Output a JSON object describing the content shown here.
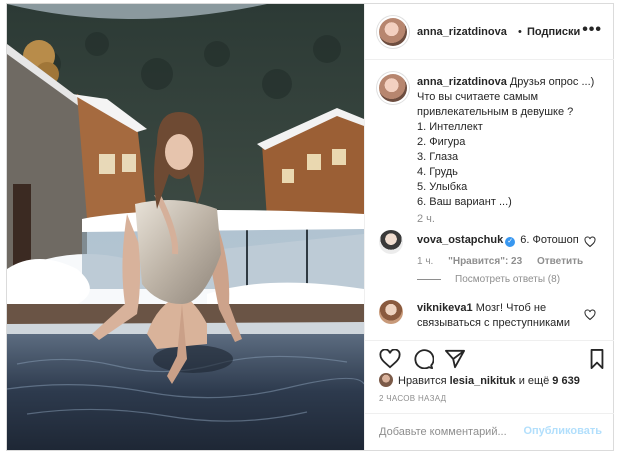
{
  "header": {
    "username": "anna_rizatdinova",
    "separator": "•",
    "follow_label": "Подписки",
    "more_icon": "more-horizontal-icon"
  },
  "caption": {
    "username": "anna_rizatdinova",
    "lines": [
      "Друзья опрос ...)",
      "Что вы считаете самым",
      "привлекательным в девушке ?",
      "1. Интеллект",
      "2. Фигура",
      "3. Глаза",
      "4. Грудь",
      "5. Улыбка",
      "6. Ваш вариант ...)"
    ],
    "time": "2 ч."
  },
  "comments": [
    {
      "username": "vova_ostapchuk",
      "verified": true,
      "text": "6. Фотошоп",
      "time": "1 ч.",
      "likes": "\"Нравится\": 23",
      "reply": "Ответить",
      "view_replies": "Посмотреть ответы (8)"
    },
    {
      "username": "viknikeva1",
      "verified": false,
      "text": "Мозг! Чтоб не связываться с преступниками"
    }
  ],
  "actions": {
    "like_icon": "heart-icon",
    "comment_icon": "comment-icon",
    "share_icon": "share-icon",
    "save_icon": "bookmark-icon"
  },
  "likes": {
    "prefix": "Нравится",
    "user": "lesia_nikituk",
    "suffix": "и ещё",
    "count": "9 639"
  },
  "timestamp": "2 ЧАСОВ НАЗАД",
  "add_comment": {
    "placeholder": "Добавьте комментарий...",
    "post_label": "Опубликовать"
  },
  "colors": {
    "link_blue": "#3897f0",
    "post_disabled": "#b2dffc",
    "muted": "#8e8e8e"
  }
}
